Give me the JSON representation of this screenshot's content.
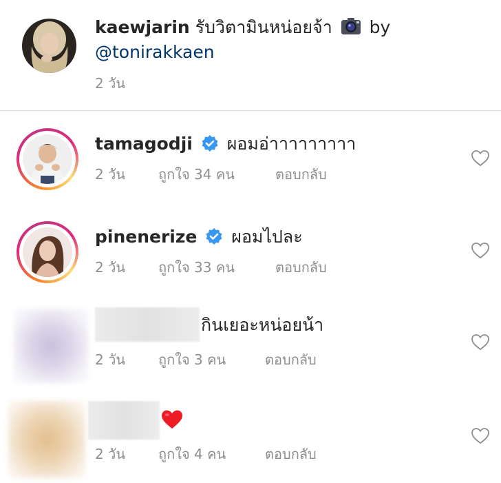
{
  "caption": {
    "username": "kaewjarin",
    "text": "รับวิตามินหน่อยจ้า",
    "camera_icon": "camera-icon",
    "by": "by",
    "mention": "@tonirakkaen",
    "time": "2 วัน"
  },
  "comments": [
    {
      "username": "tamagodji",
      "verified": true,
      "text": "ผอมอ่าาาาาาาาา",
      "time": "2 วัน",
      "likes": "ถูกใจ 34 คน",
      "reply": "ตอบกลับ"
    },
    {
      "username": "pinenerize",
      "verified": true,
      "text": "ผอมไปละ",
      "time": "2 วัน",
      "likes": "ถูกใจ 33 คน",
      "reply": "ตอบกลับ"
    },
    {
      "username": "",
      "verified": false,
      "text": "กินเยอะหน่อยน้า",
      "time": "2 วัน",
      "likes": "ถูกใจ 3 คน",
      "reply": "ตอบกลับ"
    },
    {
      "username": "",
      "verified": false,
      "text": "",
      "emoji": "red-heart-emoji",
      "time": "2 วัน",
      "likes": "ถูกใจ 4 คน",
      "reply": "ตอบกลับ"
    }
  ],
  "colors": {
    "verified_blue": "#3897f0",
    "meta_gray": "#8e8e8e",
    "mention_blue": "#003569",
    "heart_red": "#ed1c24"
  }
}
